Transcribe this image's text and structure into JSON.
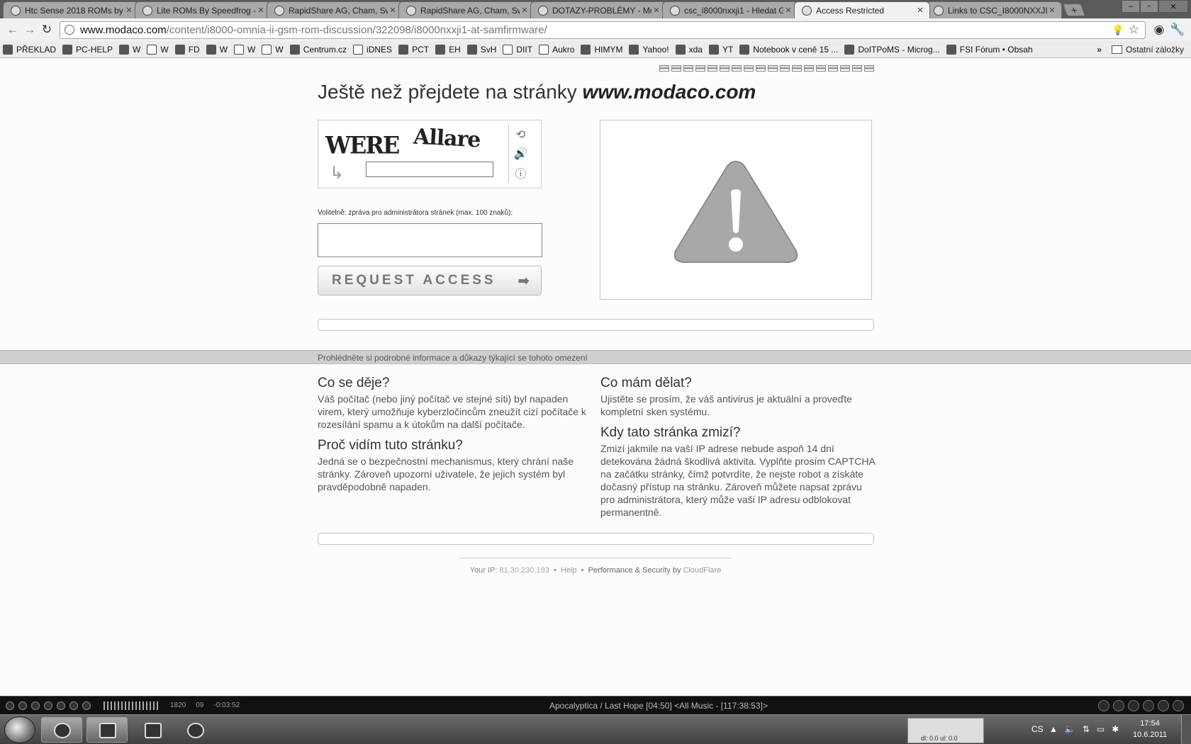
{
  "tabs": [
    {
      "title": "Htc Sense 2018 ROMs by S",
      "active": false
    },
    {
      "title": "Lite ROMs By Speedfrog -",
      "active": false
    },
    {
      "title": "RapidShare AG, Cham, Sw",
      "active": false
    },
    {
      "title": "RapidShare AG, Cham, Sw",
      "active": false
    },
    {
      "title": "DOTAZY-PROBLÉMY - Mo",
      "active": false
    },
    {
      "title": "csc_i8000nxxji1 - Hledat Gc",
      "active": false
    },
    {
      "title": "Access Restricted",
      "active": true
    },
    {
      "title": "Links to CSC_I8000NXXJI1",
      "active": false
    }
  ],
  "toolbar": {
    "url_host": "www.modaco.com",
    "url_path": "/content/i8000-omnia-ii-gsm-rom-discussion/322098/i8000nxxji1-at-samfirmware/"
  },
  "bookmarks": [
    {
      "label": "PŘEKLAD"
    },
    {
      "label": "PC-HELP"
    },
    {
      "label": "W"
    },
    {
      "label": "W"
    },
    {
      "label": "FD"
    },
    {
      "label": "W"
    },
    {
      "label": "W"
    },
    {
      "label": "W"
    },
    {
      "label": "Centrum.cz"
    },
    {
      "label": "iDNES"
    },
    {
      "label": "PCT"
    },
    {
      "label": "EH"
    },
    {
      "label": "SvH"
    },
    {
      "label": "DIIT"
    },
    {
      "label": "Aukro"
    },
    {
      "label": "HIMYM"
    },
    {
      "label": "Yahoo!"
    },
    {
      "label": "xda"
    },
    {
      "label": "YT"
    },
    {
      "label": "Notebook v ceně 15 ..."
    },
    {
      "label": "DoITPoMS - Microg..."
    },
    {
      "label": "FSI Fórum • Obsah"
    }
  ],
  "bookmarks_more": "»",
  "bookmarks_other": "Ostatní záložky",
  "page": {
    "headline_prefix": "Ještě než přejdete na stránky",
    "headline_site": "www.modaco.com",
    "captcha_word1": "WERE",
    "captcha_word2": "Allare",
    "optional_label": "Volitelně: zpráva pro administrátora stránek (max. 100 znaků):",
    "request_button": "REQUEST ACCESS",
    "infobar_text": "Prohlédněte si podrobné informace a důkazy týkající se tohoto omezení",
    "q1_title": "Co se děje?",
    "q1_text": "Váš počítač (nebo jiný počítač ve stejné síti) byl napaden virem, který umožňuje kyberzločincům zneužít cizí počítače k rozesílání spamu a k útokům na další počítače.",
    "q2_title": "Proč vidím tuto stránku?",
    "q2_text": "Jedná se o bezpečnostní mechanismus, který chrání naše stránky. Zároveň upozorní uživatele, že jejich systém byl pravděpodobně napaden.",
    "q3_title": "Co mám dělat?",
    "q3_text": "Ujistěte se prosím, že váš antivirus je aktuální a proveďte kompletní sken systému.",
    "q4_title": "Kdy tato stránka zmizí?",
    "q4_text": "Zmizí jakmile na vaší IP adrese nebude aspoň 14 dní detekována žádná škodlivá aktivita. Vyplňte prosím CAPTCHA na začátku stránky, čímž potvrdíte, že nejste robot a získáte dočasný přístup na stránku. Zároveň můžete napsat zprávu pro administrátora, který může vaši IP adresu odblokovat permanentně.",
    "footer_ip_label": "Your IP:",
    "footer_ip": "81.30.230.193",
    "footer_help": "Help",
    "footer_perf": "Performance & Security by",
    "footer_cf": "CloudFlare"
  },
  "media": {
    "pos_a": "1820",
    "pos_b": "09",
    "time": "-0:03:52",
    "track": "Apocalyptica / Last Hope  [04:50]    <All Music - [117:38:53]>"
  },
  "taskbar": {
    "lang": "CS",
    "time": "17:54",
    "date": "10.6.2011",
    "graph_label": "dl: 0.0 ul: 0.0"
  }
}
